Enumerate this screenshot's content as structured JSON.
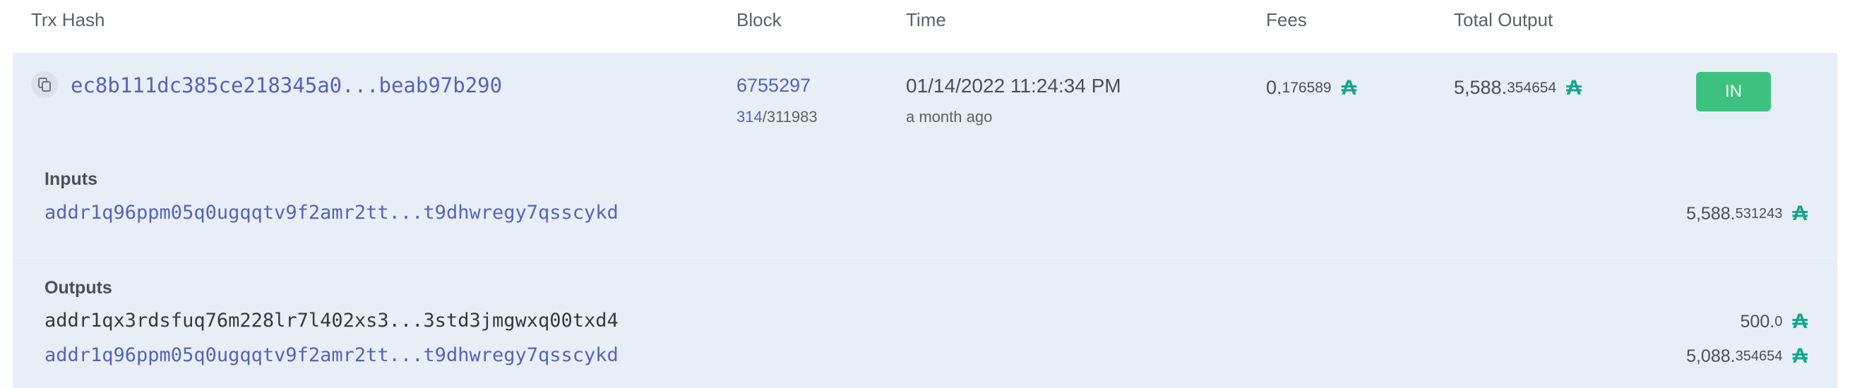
{
  "table": {
    "headers": {
      "hash": "Trx Hash",
      "block": "Block",
      "time": "Time",
      "fees": "Fees",
      "total_output": "Total Output"
    }
  },
  "transaction": {
    "hash": "ec8b111dc385ce218345a0...beab97b290",
    "block": "6755297",
    "block_index": "314",
    "block_total": "/311983",
    "time": "01/14/2022 11:24:34 PM",
    "time_ago": "a month ago",
    "fees": {
      "int": "0.",
      "dec": "176589"
    },
    "total_output": {
      "int": "5,588.",
      "dec": "354654"
    },
    "direction": "IN"
  },
  "inputs": {
    "title": "Inputs",
    "items": [
      {
        "address": "addr1q96ppm05q0ugqqtv9f2amr2tt...t9dhwregy7qsscykd",
        "int": "5,588.",
        "dec": "531243"
      }
    ]
  },
  "outputs": {
    "title": "Outputs",
    "items": [
      {
        "address": "addr1qx3rdsfuq76m228lr7l402xs3...3std3jmgwxq00txd4",
        "int": "500.",
        "dec": "0"
      },
      {
        "address": "addr1q96ppm05q0ugqqtv9f2amr2tt...t9dhwregy7qsscykd",
        "int": "5,088.",
        "dec": "354654"
      }
    ]
  },
  "currency_symbol": "₳",
  "colors": {
    "accent": "#17a689",
    "link": "#5464b8",
    "badge": "#3cc27e",
    "panel": "#e8eef5"
  },
  "icons": {
    "copy": "copy-icon",
    "currency": "ada-icon"
  }
}
